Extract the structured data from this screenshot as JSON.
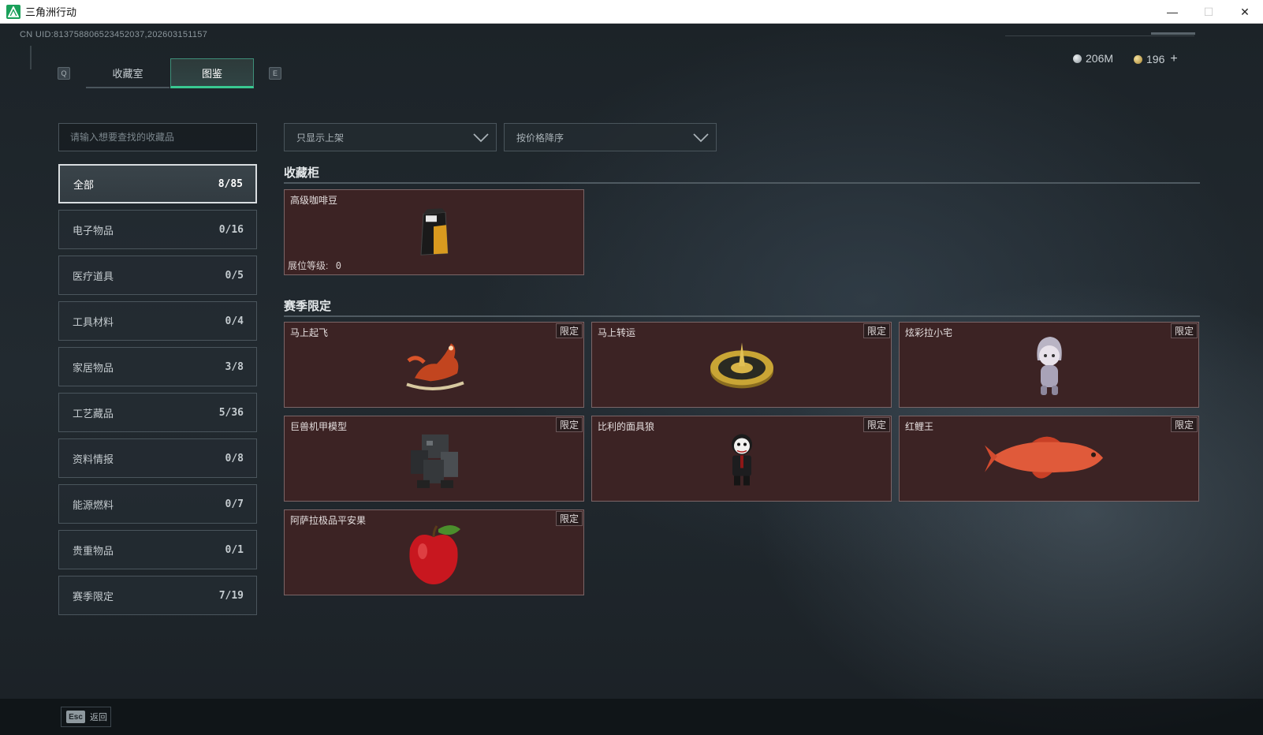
{
  "window": {
    "title": "三角洲行动",
    "minimize_icon": "—",
    "maximize_icon": "☐",
    "close_icon": "✕"
  },
  "header": {
    "uid": "CN UID:813758806523452037,202603151157",
    "currency": [
      {
        "icon": "silver-coin-icon",
        "value": "206M"
      },
      {
        "icon": "gold-coin-icon",
        "value": "196"
      }
    ],
    "add_label": "+"
  },
  "tabs": {
    "prev_key": "Q",
    "next_key": "E",
    "items": [
      {
        "label": "收藏室",
        "active": false
      },
      {
        "label": "图鉴",
        "active": true
      }
    ]
  },
  "search": {
    "placeholder": "请输入想要查找的收藏品",
    "value": ""
  },
  "categories": [
    {
      "label": "全部",
      "count": "8/85",
      "active": true
    },
    {
      "label": "电子物品",
      "count": "0/16"
    },
    {
      "label": "医疗道具",
      "count": "0/5"
    },
    {
      "label": "工具材料",
      "count": "0/4"
    },
    {
      "label": "家居物品",
      "count": "3/8"
    },
    {
      "label": "工艺藏品",
      "count": "5/36"
    },
    {
      "label": "资料情报",
      "count": "0/8"
    },
    {
      "label": "能源燃料",
      "count": "0/7"
    },
    {
      "label": "贵重物品",
      "count": "0/1"
    },
    {
      "label": "赛季限定",
      "count": "7/19"
    }
  ],
  "filters": {
    "listing": "只显示上架",
    "sort": "按价格降序"
  },
  "sections": {
    "cabinet": {
      "title": "收藏柜",
      "items": [
        {
          "name": "高级咖啡豆",
          "level_label": "展位等级:",
          "level": "0",
          "icon": "coffee-bag-icon"
        }
      ]
    },
    "season": {
      "title": "赛季限定",
      "tag": "限定",
      "items": [
        {
          "name": "马上起飞",
          "icon": "rocking-horse-icon"
        },
        {
          "name": "马上转运",
          "icon": "gold-roulette-icon"
        },
        {
          "name": "炫彩拉小宅",
          "icon": "hooded-figurine-icon"
        },
        {
          "name": "巨兽机甲模型",
          "icon": "mech-model-icon"
        },
        {
          "name": "比利的面具狼",
          "icon": "masked-doll-icon"
        },
        {
          "name": "红鲤王",
          "icon": "red-carp-icon"
        },
        {
          "name": "阿萨拉极品平安果",
          "icon": "red-apple-icon"
        }
      ]
    }
  },
  "footer": {
    "esc_key": "Esc",
    "back_label": "返回"
  },
  "colors": {
    "accent": "#39c891",
    "card_bg": "#3c2324",
    "card_border": "#7b6567"
  }
}
